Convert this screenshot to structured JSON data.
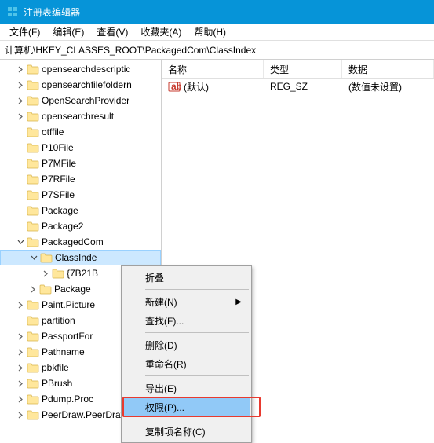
{
  "window": {
    "title": "注册表编辑器"
  },
  "menubar": {
    "file": "文件(F)",
    "edit": "编辑(E)",
    "view": "查看(V)",
    "favorites": "收藏夹(A)",
    "help": "帮助(H)"
  },
  "address": {
    "path": "计算机\\HKEY_CLASSES_ROOT\\PackagedCom\\ClassIndex"
  },
  "tree": {
    "items": [
      {
        "label": "opensearchdescriptic",
        "depth": 1,
        "exp": "closed"
      },
      {
        "label": "opensearchfilefoldern",
        "depth": 1,
        "exp": "closed"
      },
      {
        "label": "OpenSearchProvider",
        "depth": 1,
        "exp": "closed"
      },
      {
        "label": "opensearchresult",
        "depth": 1,
        "exp": "closed"
      },
      {
        "label": "otffile",
        "depth": 1,
        "exp": "none"
      },
      {
        "label": "P10File",
        "depth": 1,
        "exp": "none"
      },
      {
        "label": "P7MFile",
        "depth": 1,
        "exp": "none"
      },
      {
        "label": "P7RFile",
        "depth": 1,
        "exp": "none"
      },
      {
        "label": "P7SFile",
        "depth": 1,
        "exp": "none"
      },
      {
        "label": "Package",
        "depth": 1,
        "exp": "none"
      },
      {
        "label": "Package2",
        "depth": 1,
        "exp": "none"
      },
      {
        "label": "PackagedCom",
        "depth": 1,
        "exp": "open"
      },
      {
        "label": "ClassInde",
        "depth": 2,
        "exp": "open",
        "selected": true
      },
      {
        "label": "{7B21B",
        "depth": 3,
        "exp": "closed"
      },
      {
        "label": "Package",
        "depth": 2,
        "exp": "closed"
      },
      {
        "label": "Paint.Picture",
        "depth": 1,
        "exp": "closed"
      },
      {
        "label": "partition",
        "depth": 1,
        "exp": "none"
      },
      {
        "label": "PassportFor",
        "depth": 1,
        "exp": "closed"
      },
      {
        "label": "Pathname",
        "depth": 1,
        "exp": "closed"
      },
      {
        "label": "pbkfile",
        "depth": 1,
        "exp": "closed"
      },
      {
        "label": "PBrush",
        "depth": 1,
        "exp": "closed"
      },
      {
        "label": "Pdump.Proc",
        "depth": 1,
        "exp": "closed"
      },
      {
        "label": "PeerDraw.PeerDraw",
        "depth": 1,
        "exp": "closed"
      }
    ]
  },
  "list": {
    "headers": {
      "name": "名称",
      "type": "类型",
      "data": "数据"
    },
    "rows": [
      {
        "name": "(默认)",
        "type": "REG_SZ",
        "data": "(数值未设置)"
      }
    ]
  },
  "context_menu": {
    "collapse": "折叠",
    "new": "新建(N)",
    "find": "查找(F)...",
    "delete": "删除(D)",
    "rename": "重命名(R)",
    "export": "导出(E)",
    "permissions": "权限(P)...",
    "copy_key_name": "复制项名称(C)"
  }
}
